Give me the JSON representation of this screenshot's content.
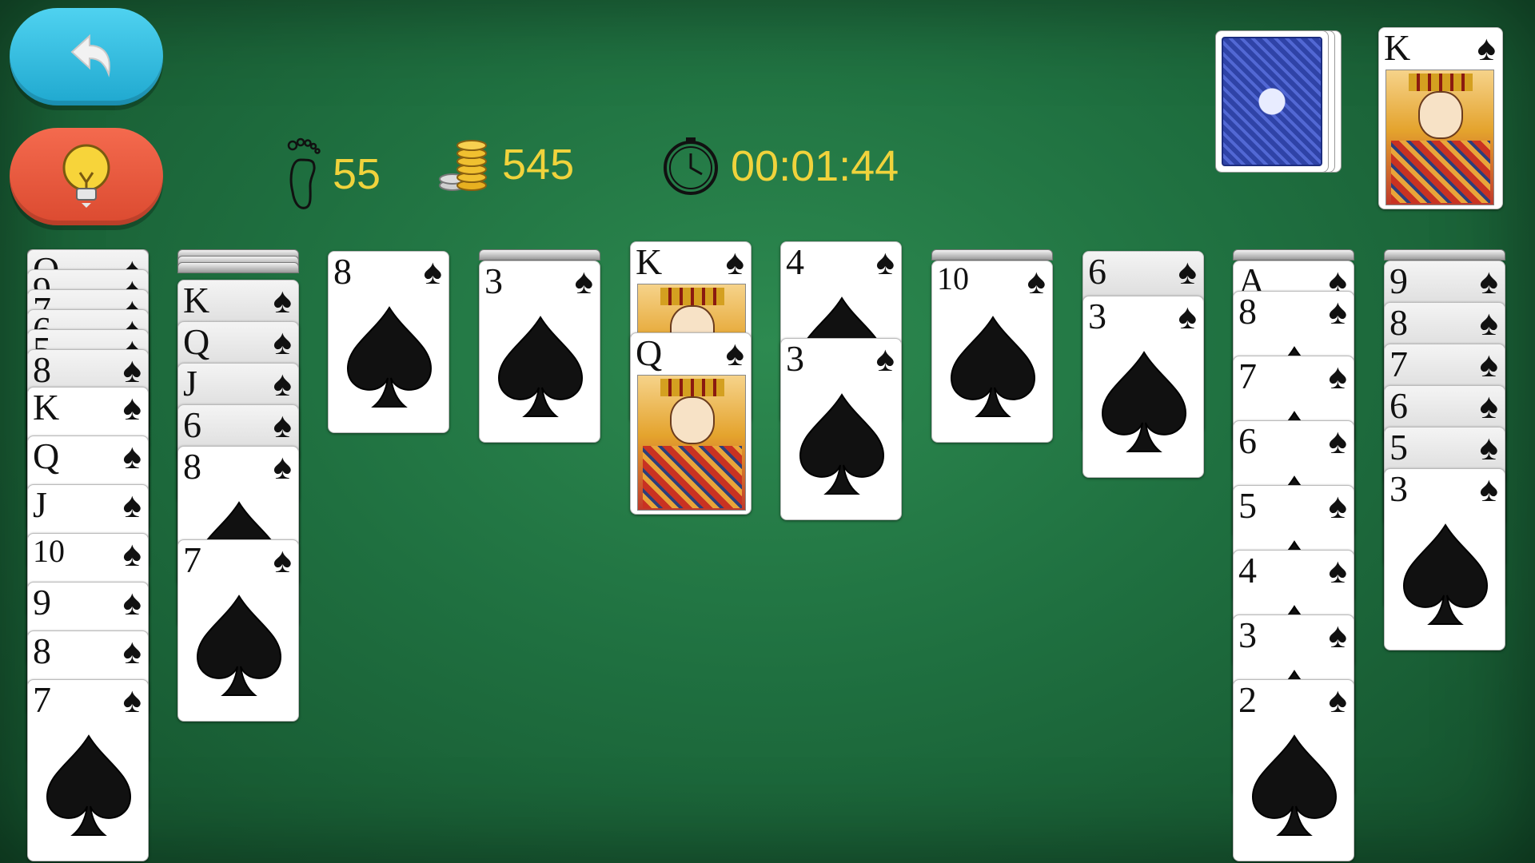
{
  "buttons": {
    "undo_icon": "undo-arrow-icon",
    "hint_icon": "lightbulb-icon",
    "undo_color": "#2ab8dd",
    "hint_color": "#e8533a"
  },
  "hud": {
    "moves": "55",
    "coins": "545",
    "timer": "00:01:44",
    "text_color": "#f0d33c"
  },
  "foundation": {
    "completed_top": {
      "rank": "K",
      "suit": "♠"
    }
  },
  "stock": {
    "remaining_stacks": 3
  },
  "tableau": [
    {
      "facedown": [
        "Q",
        "9",
        "7",
        "6",
        "5",
        "8"
      ],
      "faceup": [
        "K",
        "Q",
        "J",
        "10",
        "9",
        "8",
        "7"
      ]
    },
    {
      "facedown_count": 3,
      "faceup": [
        "K",
        "Q",
        "J",
        "6",
        "8",
        "7"
      ]
    },
    {
      "facedown_count": 0,
      "faceup": [
        "8"
      ]
    },
    {
      "facedown_count": 1,
      "faceup": [
        "3"
      ]
    },
    {
      "facedown_count": 0,
      "faceup": [
        "K",
        "Q"
      ]
    },
    {
      "facedown_count": 0,
      "faceup": [
        "4",
        "3"
      ]
    },
    {
      "facedown_count": 1,
      "faceup": [
        "10"
      ]
    },
    {
      "facedown_count": 0,
      "faceup": [
        "6",
        "3"
      ]
    },
    {
      "facedown_count": 1,
      "faceup": [
        "A",
        "8",
        "7",
        "6",
        "5",
        "4",
        "3",
        "2"
      ]
    },
    {
      "facedown_count": 1,
      "faceup": [
        "9",
        "8",
        "7",
        "6",
        "5",
        "3"
      ]
    }
  ],
  "suit_symbol": "♠"
}
